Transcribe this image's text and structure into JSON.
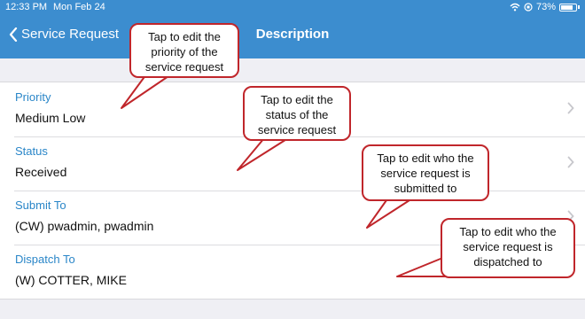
{
  "status_bar": {
    "time": "12:33 PM",
    "date": "Mon Feb 24",
    "battery": "73%"
  },
  "nav": {
    "back_label": "Service Request",
    "title": "Description"
  },
  "fields": [
    {
      "label": "Priority",
      "value": "Medium Low"
    },
    {
      "label": "Status",
      "value": "Received"
    },
    {
      "label": "Submit To",
      "value": "(CW) pwadmin, pwadmin"
    },
    {
      "label": "Dispatch To",
      "value": "(W) COTTER, MIKE"
    }
  ],
  "callouts": [
    "Tap to edit the priority of the service request",
    "Tap to edit the status of the service request",
    "Tap to edit who the service request is submitted to",
    "Tap to edit who the service request is dispatched to"
  ],
  "colors": {
    "nav_bar": "#3c8dcf",
    "label": "#2a86c8",
    "callout_border": "#c0262b"
  }
}
